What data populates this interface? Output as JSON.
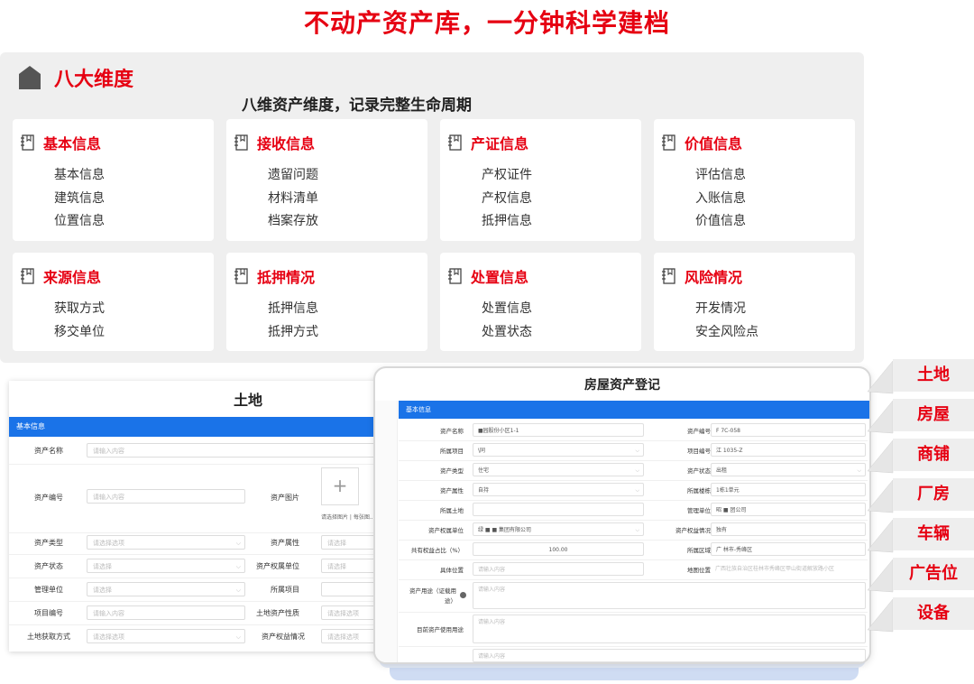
{
  "headline": "不动产资产库，一分钟科学建档",
  "section": {
    "title": "八大维度",
    "subtitle": "八维资产维度，记录完整生命周期",
    "cards": [
      {
        "title": "基本信息",
        "items": [
          "基本信息",
          "建筑信息",
          "位置信息"
        ]
      },
      {
        "title": "接收信息",
        "items": [
          "遗留问题",
          "材料清单",
          "档案存放"
        ]
      },
      {
        "title": "产证信息",
        "items": [
          "产权证件",
          "产权信息",
          "抵押信息"
        ]
      },
      {
        "title": "价值信息",
        "items": [
          "评估信息",
          "入账信息",
          "价值信息"
        ]
      },
      {
        "title": "来源信息",
        "items": [
          "获取方式",
          "移交单位"
        ]
      },
      {
        "title": "抵押情况",
        "items": [
          "抵押信息",
          "抵押方式"
        ]
      },
      {
        "title": "处置信息",
        "items": [
          "处置信息",
          "处置状态"
        ]
      },
      {
        "title": "风险情况",
        "items": [
          "开发情况",
          "安全风险点"
        ]
      }
    ]
  },
  "land_form": {
    "title": "土地",
    "bar": "基本信息",
    "asset_name": {
      "label": "资产名称",
      "placeholder": "请输入内容"
    },
    "asset_code": {
      "label": "资产编号",
      "placeholder": "请输入内容"
    },
    "asset_image": {
      "label": "资产图片",
      "hint": "请选择图片 | 每张图..."
    },
    "rows": [
      {
        "l1": "资产类型",
        "v1": "请选择选项",
        "l2": "资产属性",
        "v2": "请选择"
      },
      {
        "l1": "资产状态",
        "v1": "请选择",
        "l2": "资产权属单位",
        "v2": "请选择"
      },
      {
        "l1": "管理单位",
        "v1": "请选择",
        "l2": "所属项目",
        "v2": ""
      },
      {
        "l1": "项目编号",
        "v1": "请输入内容",
        "l2": "土地资产性质",
        "v2": "请选择选项"
      },
      {
        "l1": "土地获取方式",
        "v1": "请选择选项",
        "l2": "资产权益情况",
        "v2": "请选择选项"
      }
    ]
  },
  "house_form": {
    "title": "房屋资产登记",
    "bar": "基本信息",
    "rows": [
      {
        "l1": "资产名称",
        "v1": "          ■园股份小区1-1",
        "l2": "资产编号",
        "v2": "F        7C-058"
      },
      {
        "l1": "所属项目",
        "v1": "  \\同",
        "l2": "项目编号",
        "v2": "江          1035-Z"
      },
      {
        "l1": "资产类型",
        "v1": "住宅",
        "l2": "资产状态",
        "v2": "出租"
      },
      {
        "l1": "资产属性",
        "v1": "自持",
        "l2": "所属楼栋",
        "v2": "1栋1单元"
      },
      {
        "l1": "所属土地",
        "v1": "",
        "l2": "管理单位",
        "v2": "昭    ■    团公司"
      },
      {
        "l1": "资产权属单位",
        "v1": "绿   ■  ■  集团有限公司",
        "l2": "资产权益情况",
        "v2": "独有"
      },
      {
        "l1": "共有权益占比（%）",
        "v1": "100.00",
        "l2": "所属区域",
        "v2": "广          林市-秀峰区"
      },
      {
        "l1": "具体位置",
        "v1": "请输入内容",
        "l2": "地图位置",
        "v2": "广西壮族自治区桂林市秀峰区甲山街道解放路小区"
      },
      {
        "l1": "资产用途（证载用途）",
        "v1": "请输入内容"
      },
      {
        "l1": "目前资产使用用途",
        "v1": "请输入内容"
      },
      {
        "l1": "",
        "v1": "请输入内容"
      }
    ]
  },
  "categories": [
    "土地",
    "房屋",
    "商铺",
    "厂房",
    "车辆",
    "广告位",
    "设备"
  ],
  "colors": {
    "accent": "#e60012",
    "blue": "#1a73e8",
    "panel": "#efefef"
  }
}
